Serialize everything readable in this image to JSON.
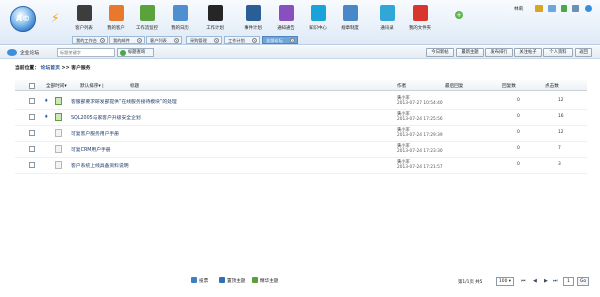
{
  "app": {
    "logo_text": "A©",
    "user_name": "林莉"
  },
  "nav": [
    {
      "label": "客户列表",
      "icon": "folder-icon",
      "color": "#3d3d3d"
    },
    {
      "label": "我的客户",
      "icon": "briefcase-icon",
      "color": "#e8792c"
    },
    {
      "label": "工作流监控",
      "icon": "workflow-icon",
      "color": "#5aa33c"
    },
    {
      "label": "我的日历",
      "icon": "calendar-icon",
      "color": "#4f8fd0"
    },
    {
      "label": "工作计划",
      "icon": "plan-icon",
      "color": "#262626"
    },
    {
      "label": "事件计划",
      "icon": "person-icon",
      "color": "#2a5f96"
    },
    {
      "label": "通知通告",
      "icon": "tools-icon",
      "color": "#8a4fbf"
    },
    {
      "label": "知识中心",
      "icon": "knowledge-icon",
      "color": "#1aa3d9"
    },
    {
      "label": "规章制度",
      "icon": "rules-icon",
      "color": "#4a87c9"
    },
    {
      "label": "通讯录",
      "icon": "phone-icon",
      "color": "#31a7d8"
    },
    {
      "label": "我的文件夹",
      "icon": "flag-icon",
      "color": "#d8362c"
    }
  ],
  "tabs": [
    {
      "label": "我的工作台",
      "active": false
    },
    {
      "label": "我的邮件",
      "active": false
    },
    {
      "label": "客户列表",
      "active": false
    },
    {
      "label": "采购管理",
      "active": false
    },
    {
      "label": "工作计划",
      "active": false
    },
    {
      "label": "全部论坛",
      "active": true
    }
  ],
  "toolbar": {
    "company_label": "企业论坛",
    "search_placeholder": "标题关键字",
    "search_button": "标题查询",
    "actions": [
      "今日新帖",
      "最新主题",
      "发布排行",
      "关注帖子",
      "个人资料",
      "返回"
    ]
  },
  "location": {
    "prefix": "当前位置：",
    "home": "论坛首页",
    "sep": ">>",
    "current": "客户服务"
  },
  "grid": {
    "headers": {
      "time": "全部时间",
      "sort": "默认排序",
      "title": "标题",
      "author": "作者",
      "last_reply": "最后回复",
      "replies": "回复数",
      "clicks": "点击数"
    },
    "rows": [
      {
        "pinned": true,
        "doc": "image",
        "title": "客服部要求研发部提供“在线服务接待模块”的处理",
        "author": "黄小军",
        "date": "2013-07-27 10:54:40",
        "replies": "0",
        "clicks": "12"
      },
      {
        "pinned": true,
        "doc": "image",
        "title": "SQL2005与家客户升级安全企划",
        "author": "黄小军",
        "date": "2013-07-24 17:25:56",
        "replies": "0",
        "clicks": "16"
      },
      {
        "pinned": false,
        "doc": "plain",
        "title": "可复客户服务用户手册",
        "author": "黄小军",
        "date": "2013-07-24 17:29:39",
        "replies": "0",
        "clicks": "12"
      },
      {
        "pinned": false,
        "doc": "plain",
        "title": "可复CRM用户手册",
        "author": "黄小军",
        "date": "2013-07-24 17:23:30",
        "replies": "0",
        "clicks": "7"
      },
      {
        "pinned": false,
        "doc": "plain",
        "title": "客户系统上线具备资料说明",
        "author": "黄小军",
        "date": "2013-07-24 17:21:57",
        "replies": "0",
        "clicks": "3"
      }
    ]
  },
  "footer": {
    "tools": [
      {
        "label": "投票",
        "icon": "chart-icon",
        "color": "#3f7fc4"
      },
      {
        "label": "置顶主题",
        "icon": "pin-icon",
        "color": "#2e6fb6"
      },
      {
        "label": "精华主题",
        "icon": "image-icon",
        "color": "#5b9e3e"
      }
    ],
    "pager_text": "第1/1页 共5",
    "page_size": "100",
    "page_input": "1",
    "go_label": "Go"
  }
}
